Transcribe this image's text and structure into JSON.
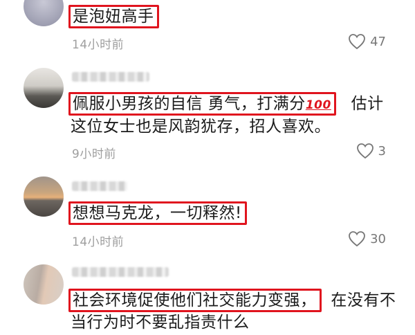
{
  "comments": [
    {
      "text_highlight": "是泡妞高手",
      "text_rest": "",
      "time": "14小时前",
      "likes": "47"
    },
    {
      "text_highlight": "佩服小男孩的自信 勇气，打满分",
      "text_highlight_emoji": "100",
      "text_rest_line1": "估计",
      "text_rest_line2": "这位女士也是风韵犹存，招人喜欢。",
      "time": "9小时前",
      "likes": "3"
    },
    {
      "text_highlight": "想想马克龙，一切释然!",
      "time": "14小时前",
      "likes": "30"
    },
    {
      "text_highlight": "社会环境促使他们社交能力变强，",
      "text_rest_line1": "在没有不",
      "text_rest_line2": "当行为时不要乱指责什么"
    }
  ],
  "icons": {
    "like": "heart-outline-icon"
  },
  "colors": {
    "highlight_border": "#e0141e",
    "time": "#9e9e9e"
  }
}
